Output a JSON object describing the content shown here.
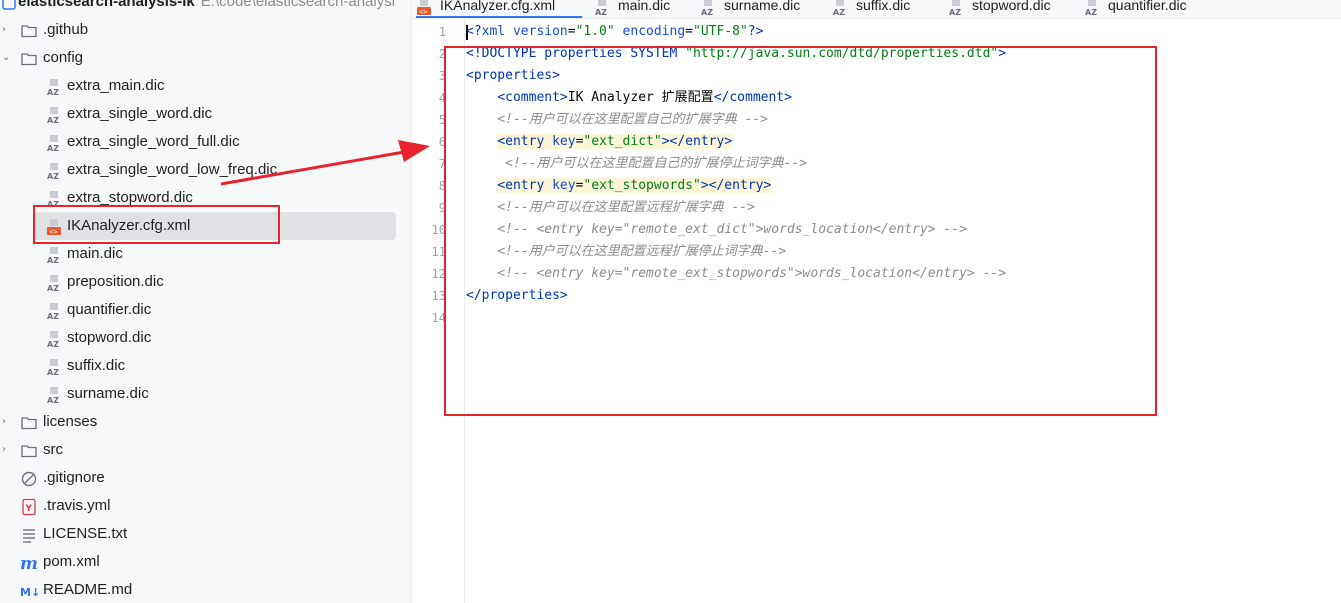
{
  "project_tree": {
    "root": {
      "label": "elasticsearch-analysis-ik",
      "path": "E:\\code\\elasticsearch-analysi"
    },
    "rows": [
      {
        "label": ".github",
        "kind": "folder",
        "expanded": false,
        "indent": 0
      },
      {
        "label": "config",
        "kind": "folder",
        "expanded": true,
        "indent": 0
      },
      {
        "label": "extra_main.dic",
        "kind": "dic",
        "indent": 1
      },
      {
        "label": "extra_single_word.dic",
        "kind": "dic",
        "indent": 1
      },
      {
        "label": "extra_single_word_full.dic",
        "kind": "dic",
        "indent": 1
      },
      {
        "label": "extra_single_word_low_freq.dic",
        "kind": "dic",
        "indent": 1
      },
      {
        "label": "extra_stopword.dic",
        "kind": "dic",
        "indent": 1
      },
      {
        "label": "IKAnalyzer.cfg.xml",
        "kind": "xml",
        "indent": 1,
        "selected": true
      },
      {
        "label": "main.dic",
        "kind": "dic",
        "indent": 1
      },
      {
        "label": "preposition.dic",
        "kind": "dic",
        "indent": 1
      },
      {
        "label": "quantifier.dic",
        "kind": "dic",
        "indent": 1
      },
      {
        "label": "stopword.dic",
        "kind": "dic",
        "indent": 1
      },
      {
        "label": "suffix.dic",
        "kind": "dic",
        "indent": 1
      },
      {
        "label": "surname.dic",
        "kind": "dic",
        "indent": 1
      },
      {
        "label": "licenses",
        "kind": "folder",
        "expanded": false,
        "indent": 0
      },
      {
        "label": "src",
        "kind": "folder",
        "expanded": false,
        "indent": 0
      },
      {
        "label": ".gitignore",
        "kind": "gitignore",
        "indent": 0
      },
      {
        "label": ".travis.yml",
        "kind": "yml",
        "indent": 0
      },
      {
        "label": "LICENSE.txt",
        "kind": "txt",
        "indent": 0
      },
      {
        "label": "pom.xml",
        "kind": "maven",
        "indent": 0
      },
      {
        "label": "README.md",
        "kind": "md",
        "indent": 0
      }
    ]
  },
  "editor_tabs": [
    {
      "label": "IKAnalyzer.cfg.xml",
      "kind": "xml",
      "active": true
    },
    {
      "label": "main.dic",
      "kind": "dic"
    },
    {
      "label": "surname.dic",
      "kind": "dic"
    },
    {
      "label": "suffix.dic",
      "kind": "dic"
    },
    {
      "label": "stopword.dic",
      "kind": "dic"
    },
    {
      "label": "quantifier.dic",
      "kind": "dic"
    }
  ],
  "code_lines": [
    {
      "n": "1",
      "hl": false,
      "tokens": [
        [
          "t-tag",
          "<?"
        ],
        [
          "t-attr",
          "xml version"
        ],
        [
          "t-txt",
          "="
        ],
        [
          "t-str",
          "\"1.0\""
        ],
        [
          "t-txt",
          " "
        ],
        [
          "t-attr",
          "encoding"
        ],
        [
          "t-txt",
          "="
        ],
        [
          "t-str",
          "\"UTF-8\""
        ],
        [
          "t-tag",
          "?>"
        ]
      ]
    },
    {
      "n": "2",
      "hl": false,
      "tokens": [
        [
          "t-tag",
          "<!DOCTYPE properties SYSTEM "
        ],
        [
          "t-str",
          "\"http://java.sun.com/dtd/properties.dtd\""
        ],
        [
          "t-tag",
          ">"
        ]
      ]
    },
    {
      "n": "3",
      "hl": false,
      "tokens": [
        [
          "t-tag",
          "<properties>"
        ]
      ]
    },
    {
      "n": "4",
      "hl": false,
      "tokens": [
        [
          "t-txt",
          "    "
        ],
        [
          "t-tag",
          "<comment>"
        ],
        [
          "t-txt",
          "IK Analyzer 扩展配置"
        ],
        [
          "t-tag",
          "</comment>"
        ]
      ]
    },
    {
      "n": "5",
      "hl": false,
      "tokens": [
        [
          "t-txt",
          "    "
        ],
        [
          "t-com",
          "<!--用户可以在这里配置自己的扩展字典 -->"
        ]
      ]
    },
    {
      "n": "6",
      "hl": true,
      "tokens": [
        [
          "t-txt",
          "    "
        ],
        [
          "t-tag",
          "<entry "
        ],
        [
          "t-attr",
          "key"
        ],
        [
          "t-txt",
          "="
        ],
        [
          "t-str",
          "\"ext_dict\""
        ],
        [
          "t-tag",
          "></entry>"
        ]
      ]
    },
    {
      "n": "7",
      "hl": false,
      "tokens": [
        [
          "t-txt",
          "     "
        ],
        [
          "t-com",
          "<!--用户可以在这里配置自己的扩展停止词字典-->"
        ]
      ]
    },
    {
      "n": "8",
      "hl": true,
      "tokens": [
        [
          "t-txt",
          "    "
        ],
        [
          "t-tag",
          "<entry "
        ],
        [
          "t-attr",
          "key"
        ],
        [
          "t-txt",
          "="
        ],
        [
          "t-str",
          "\"ext_stopwords\""
        ],
        [
          "t-tag",
          "></entry>"
        ]
      ]
    },
    {
      "n": "9",
      "hl": false,
      "tokens": [
        [
          "t-txt",
          "    "
        ],
        [
          "t-com",
          "<!--用户可以在这里配置远程扩展字典 -->"
        ]
      ]
    },
    {
      "n": "10",
      "hl": false,
      "tokens": [
        [
          "t-txt",
          "    "
        ],
        [
          "t-com",
          "<!-- <entry key=\"remote_ext_dict\">words_location</entry> -->"
        ]
      ]
    },
    {
      "n": "11",
      "hl": false,
      "tokens": [
        [
          "t-txt",
          "    "
        ],
        [
          "t-com",
          "<!--用户可以在这里配置远程扩展停止词字典-->"
        ]
      ]
    },
    {
      "n": "12",
      "hl": false,
      "tokens": [
        [
          "t-txt",
          "    "
        ],
        [
          "t-com",
          "<!-- <entry key=\"remote_ext_stopwords\">words_location</entry> -->"
        ]
      ]
    },
    {
      "n": "13",
      "hl": false,
      "tokens": [
        [
          "t-tag",
          "</properties>"
        ]
      ]
    },
    {
      "n": "14",
      "hl": false,
      "tokens": []
    }
  ],
  "colors": {
    "annotation_red": "#e8232d",
    "selection_bg": "#dfe1e5",
    "line_highlight": "#fcf6d9"
  }
}
